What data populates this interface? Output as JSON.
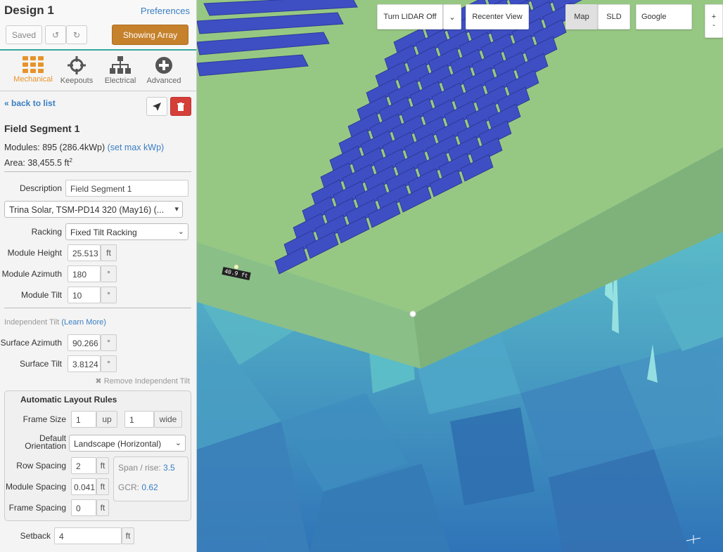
{
  "design": {
    "title": "Design 1",
    "preferences": "Preferences"
  },
  "toolbar": {
    "saved": "Saved",
    "undo_icon": "↺",
    "redo_icon": "↻",
    "showing_array": "Showing Array"
  },
  "tabs": [
    {
      "label": "Mechanical",
      "icon": "grid-icon",
      "active": true
    },
    {
      "label": "Keepouts",
      "icon": "crosshair-icon",
      "active": false
    },
    {
      "label": "Electrical",
      "icon": "sitemap-icon",
      "active": false
    },
    {
      "label": "Advanced",
      "icon": "plus-circle-icon",
      "active": false
    }
  ],
  "nav": {
    "back": "« back to list"
  },
  "segment": {
    "title": "Field Segment 1",
    "modules_text": "Modules: 895 (286.4kWp)",
    "set_max": "(set max kWp)",
    "area_text": "Area: 38,455.5 ft",
    "area_sup": "2"
  },
  "fields": {
    "description_label": "Description",
    "description_value": "Field Segment 1",
    "module_select": "Trina Solar, TSM-PD14 320 (May16) (...",
    "racking_label": "Racking",
    "racking_value": "Fixed Tilt Racking",
    "module_height_label": "Module Height",
    "module_height_value": "25.513",
    "module_height_unit": "ft",
    "module_azimuth_label": "Module Azimuth",
    "module_azimuth_value": "180",
    "module_tilt_label": "Module Tilt",
    "module_tilt_value": "10",
    "degree_unit": "°",
    "independent_tilt": "Independent Tilt",
    "learn_more": "(Learn More)",
    "surface_azimuth_label": "Surface Azimuth",
    "surface_azimuth_value": "90.266",
    "surface_tilt_label": "Surface Tilt",
    "surface_tilt_value": "3.8124",
    "remove_independent": "✖ Remove Independent Tilt"
  },
  "rules": {
    "title": "Automatic Layout Rules",
    "frame_size_label": "Frame Size",
    "frame_up_value": "1",
    "frame_up_unit": "up",
    "frame_wide_value": "1",
    "frame_wide_unit": "wide",
    "orientation_label_1": "Default",
    "orientation_label_2": "Orientation",
    "orientation_value": "Landscape (Horizontal)",
    "row_spacing_label": "Row Spacing",
    "row_spacing_value": "2",
    "module_spacing_label": "Module Spacing",
    "module_spacing_value": "0.041",
    "frame_spacing_label": "Frame Spacing",
    "frame_spacing_value": "0",
    "ft_unit": "ft",
    "span_rise_label": "Span / rise:",
    "span_rise_value": "3.5",
    "gcr_label": "GCR:",
    "gcr_value": "0.62"
  },
  "setback": {
    "label": "Setback",
    "value": "4",
    "unit": "ft"
  },
  "map_toolbar": {
    "lidar": "Turn LIDAR Off",
    "recenter": "Recenter View",
    "map": "Map",
    "sld": "SLD",
    "google": "Google",
    "zoom_in": "+",
    "zoom_out": "-"
  },
  "map_label": "40.9 ft",
  "colors": {
    "accent": "#c5812c",
    "link": "#3a7ec2",
    "danger": "#d43f3a",
    "panel": "#3e4fc4"
  }
}
